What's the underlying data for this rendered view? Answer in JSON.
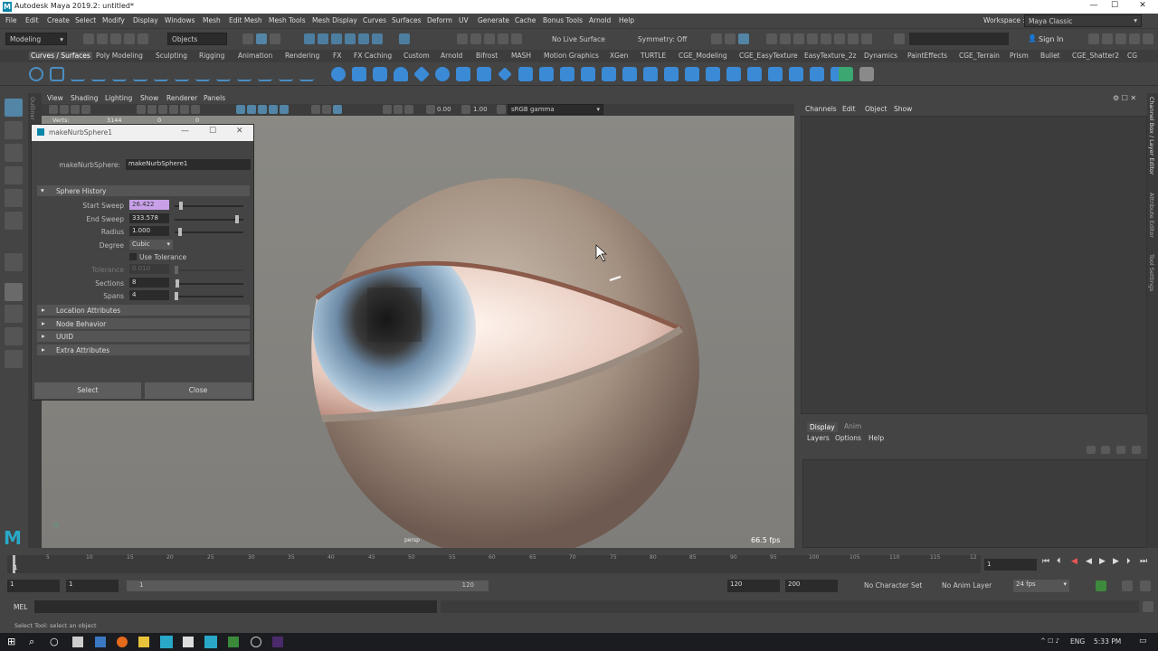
{
  "window": {
    "title": "Autodesk Maya 2019.2: untitled*",
    "logo": "M",
    "minimize": "—",
    "maximize": "☐",
    "close": "✕"
  },
  "menubar": {
    "items": [
      "File",
      "Edit",
      "Create",
      "Select",
      "Modify",
      "Display",
      "Windows",
      "Mesh",
      "Edit Mesh",
      "Mesh Tools",
      "Mesh Display",
      "Curves",
      "Surfaces",
      "Deform",
      "UV",
      "Generate",
      "Cache",
      "Bonus Tools",
      "Arnold",
      "Help"
    ],
    "workspace_label": "Workspace :",
    "workspace_value": "Maya Classic"
  },
  "statusline": {
    "menuset": "Modeling",
    "objects": "Objects",
    "live_surface": "No Live Surface",
    "symmetry": "Symmetry: Off",
    "sign_in": "Sign In"
  },
  "shelf": {
    "tabs": [
      "Curves / Surfaces",
      "Poly Modeling",
      "Sculpting",
      "Rigging",
      "Animation",
      "Rendering",
      "FX",
      "FX Caching",
      "Custom",
      "Arnold",
      "Bifrost",
      "MASH",
      "Motion Graphics",
      "XGen",
      "TURTLE",
      "CGE_Modeling",
      "CGE_EasyTexture",
      "EasyTexture_2z",
      "Dynamics",
      "PaintEffects",
      "CGE_Terrain",
      "Prism",
      "Bullet",
      "CGE_Shatter2",
      "CG"
    ],
    "active_tab": "Curves / Surfaces"
  },
  "viewport": {
    "menu": [
      "View",
      "Shading",
      "Lighting",
      "Show",
      "Renderer",
      "Panels"
    ],
    "exposure": "0.00",
    "gamma": "1.00",
    "colorspace": "sRGB gamma",
    "hud": {
      "verts_label": "Verts:",
      "verts_a": "3144",
      "verts_b": "0",
      "verts_c": "0"
    },
    "camera": "persp",
    "fps": "66.5 fps",
    "outliner_tab": "Outliner"
  },
  "dialog": {
    "title": "makeNurbSphere1",
    "node_label": "makeNurbSphere:",
    "node_value": "makeNurbSphere1",
    "section": "Sphere History",
    "fields": [
      {
        "label": "Start Sweep",
        "value": "26.422",
        "level": 0.07
      },
      {
        "label": "End Sweep",
        "value": "333.578",
        "level": 0.93
      },
      {
        "label": "Radius",
        "value": "1.000",
        "level": 0.05
      },
      {
        "label": "Degree",
        "value": "Cubic"
      },
      {
        "label": "Use Tolerance"
      },
      {
        "label": "Tolerance",
        "value": "0.010",
        "level": 0.0
      },
      {
        "label": "Sections",
        "value": "8",
        "level": 0.02
      },
      {
        "label": "Spans",
        "value": "4",
        "level": 0.0
      }
    ],
    "collapsed": [
      "Location Attributes",
      "Node Behavior",
      "UUID",
      "Extra Attributes"
    ],
    "select_label": "Select",
    "close_label": "Close"
  },
  "channelbox": {
    "menu": [
      "Channels",
      "Edit",
      "Object",
      "Show"
    ],
    "side_tabs": [
      "Channel Box / Layer Editor",
      "Attribute Editor",
      "Tool Settings"
    ]
  },
  "layers": {
    "tabs": [
      "Display",
      "Anim"
    ],
    "menu": [
      "Layers",
      "Options",
      "Help"
    ]
  },
  "timeslider": {
    "ticks": [
      "5",
      "10",
      "15",
      "20",
      "25",
      "30",
      "35",
      "40",
      "45",
      "50",
      "55",
      "60",
      "65",
      "70",
      "75",
      "80",
      "85",
      "90",
      "95",
      "100",
      "105",
      "110",
      "115",
      "12"
    ],
    "start_frame": "1",
    "current_frame": "1"
  },
  "rangeslider": {
    "start": "1",
    "inner_start": "1",
    "inner_mid": "1",
    "inner_end": "120",
    "end": "120",
    "max": "200",
    "character_set": "No Character Set",
    "anim_layer": "No Anim Layer",
    "fps": "24 fps"
  },
  "cmdline": {
    "label": "MEL"
  },
  "helpline": {
    "text": "Select Tool: select an object"
  },
  "taskbar": {
    "lang": "ENG",
    "time": "5:33 PM"
  },
  "colors": {
    "accent": "#5285a6",
    "highlight": "#c8a0e8"
  }
}
